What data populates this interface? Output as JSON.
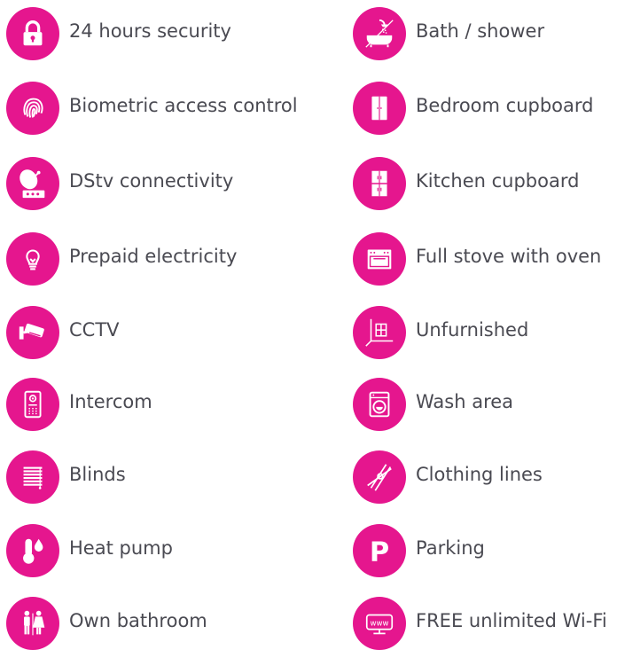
{
  "colors": {
    "accent": "#e5168e",
    "text": "#4a4a52",
    "background": "#ffffff"
  },
  "left_column": [
    {
      "icon": "padlock-icon",
      "label": "24 hours security"
    },
    {
      "icon": "fingerprint-icon",
      "label": "Biometric access control"
    },
    {
      "icon": "satellite-dish-icon",
      "label": "DStv connectivity"
    },
    {
      "icon": "light-bulb-icon",
      "label": "Prepaid electricity"
    },
    {
      "icon": "security-camera-icon",
      "label": "CCTV"
    },
    {
      "icon": "intercom-panel-icon",
      "label": "Intercom"
    },
    {
      "icon": "window-blinds-icon",
      "label": "Blinds"
    },
    {
      "icon": "thermometer-drop-icon",
      "label": "Heat pump"
    },
    {
      "icon": "man-woman-icon",
      "label": "Own bathroom"
    }
  ],
  "right_column": [
    {
      "icon": "bath-shower-icon",
      "label": "Bath / shower"
    },
    {
      "icon": "wardrobe-icon",
      "label": "Bedroom cupboard"
    },
    {
      "icon": "kitchen-cabinet-icon",
      "label": "Kitchen cupboard"
    },
    {
      "icon": "stove-oven-icon",
      "label": "Full stove with oven"
    },
    {
      "icon": "empty-room-icon",
      "label": "Unfurnished"
    },
    {
      "icon": "washing-machine-icon",
      "label": "Wash area"
    },
    {
      "icon": "clothes-peg-icon",
      "label": "Clothing lines"
    },
    {
      "icon": "parking-icon",
      "label": "Parking",
      "glyph": "P"
    },
    {
      "icon": "wifi-www-icon",
      "label": "FREE unlimited Wi-Fi",
      "glyph": "www"
    }
  ]
}
